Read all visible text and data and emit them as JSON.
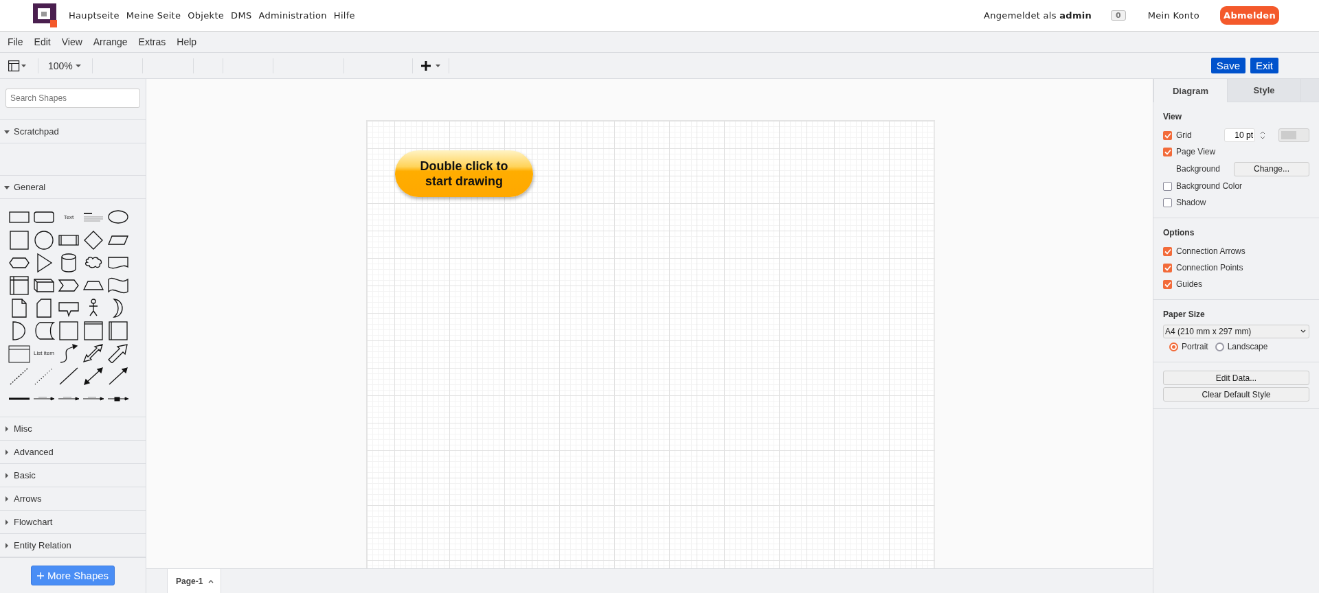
{
  "header": {
    "nav": [
      "Hauptseite",
      "Meine Seite",
      "Objekte",
      "DMS",
      "Administration",
      "Hilfe"
    ],
    "login": "Angemeldet als **admin**",
    "badge": "0",
    "account": "Mein Konto",
    "logout": "Abmelden"
  },
  "menu": [
    "File",
    "Edit",
    "View",
    "Arrange",
    "Extras",
    "Help"
  ],
  "toolbar": {
    "zoom": "100%",
    "save": "Save",
    "exit": "Exit"
  },
  "sidebar": {
    "search_placeholder": "Search Shapes",
    "sections": [
      {
        "title": "Scratchpad",
        "expanded": true,
        "kind": "scratchpad"
      },
      {
        "title": "General",
        "expanded": true,
        "kind": "shapes",
        "shapes": [
          {
            "kind": "rect"
          },
          {
            "kind": "rounded"
          },
          {
            "kind": "text",
            "label": "Text"
          },
          {
            "kind": "heading"
          },
          {
            "kind": "ellipse"
          },
          {
            "kind": "square"
          },
          {
            "kind": "circle"
          },
          {
            "kind": "process"
          },
          {
            "kind": "diamond"
          },
          {
            "kind": "parallelogram"
          },
          {
            "kind": "hexagon"
          },
          {
            "kind": "triangle"
          },
          {
            "kind": "cylinder"
          },
          {
            "kind": "cloud"
          },
          {
            "kind": "document"
          },
          {
            "kind": "internal-storage"
          },
          {
            "kind": "cube"
          },
          {
            "kind": "step"
          },
          {
            "kind": "trapezoid"
          },
          {
            "kind": "tape"
          },
          {
            "kind": "note"
          },
          {
            "kind": "card"
          },
          {
            "kind": "callout"
          },
          {
            "kind": "actor"
          },
          {
            "kind": "or"
          },
          {
            "kind": "and"
          },
          {
            "kind": "data-storage"
          },
          {
            "kind": "square"
          },
          {
            "kind": "container"
          },
          {
            "kind": "swimlane"
          },
          {
            "kind": "list"
          },
          {
            "kind": "list-item",
            "label": "List item"
          },
          {
            "kind": "curve"
          },
          {
            "kind": "bidir-block"
          },
          {
            "kind": "block-arrow"
          },
          {
            "kind": "dashed"
          },
          {
            "kind": "dotted"
          },
          {
            "kind": "line"
          },
          {
            "kind": "bidir-line"
          },
          {
            "kind": "directed-line"
          },
          {
            "kind": "thick"
          },
          {
            "kind": "edge-label"
          },
          {
            "kind": "edge-label"
          },
          {
            "kind": "edge-label"
          },
          {
            "kind": "edge-box"
          }
        ]
      },
      {
        "title": "Misc",
        "expanded": false
      },
      {
        "title": "Advanced",
        "expanded": false
      },
      {
        "title": "Basic",
        "expanded": false
      },
      {
        "title": "Arrows",
        "expanded": false
      },
      {
        "title": "Flowchart",
        "expanded": false
      },
      {
        "title": "Entity Relation",
        "expanded": false
      }
    ],
    "more_button": "More Shapes"
  },
  "canvas": {
    "hint": "Double click to start drawing"
  },
  "page_tabs": [
    {
      "label": "Page-1",
      "selected": true
    }
  ],
  "format_panel": {
    "tabs": [
      {
        "label": "Diagram",
        "selected": true
      },
      {
        "label": "Style",
        "selected": false
      }
    ],
    "view": {
      "title": "View",
      "rows": [
        {
          "kind": "grid",
          "label": "Grid",
          "checked": true,
          "value": "10 pt"
        },
        {
          "kind": "check",
          "label": "Page View",
          "checked": true
        },
        {
          "kind": "background",
          "label": "Background",
          "button": "Change..."
        },
        {
          "kind": "check",
          "label": "Background Color",
          "checked": false
        },
        {
          "kind": "check",
          "label": "Shadow",
          "checked": false
        }
      ]
    },
    "options": {
      "title": "Options",
      "rows": [
        {
          "label": "Connection Arrows",
          "checked": true
        },
        {
          "label": "Connection Points",
          "checked": true
        },
        {
          "label": "Guides",
          "checked": true
        }
      ]
    },
    "paper": {
      "title": "Paper Size",
      "value": "A4 (210 mm x 297 mm)",
      "orientations": [
        {
          "label": "Portrait",
          "selected": true
        },
        {
          "label": "Landscape",
          "selected": false
        }
      ]
    },
    "buttons": [
      "Edit Data...",
      "Clear Default Style"
    ]
  }
}
